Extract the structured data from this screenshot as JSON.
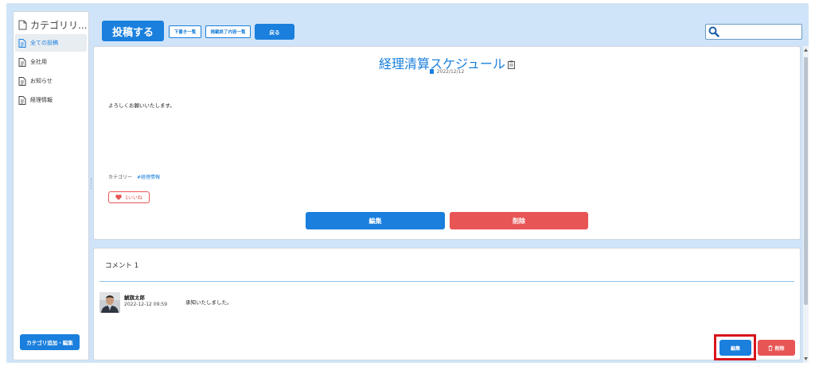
{
  "sidebar": {
    "title": "カテゴリリ...",
    "items": [
      {
        "label": "全ての投稿",
        "active": true
      },
      {
        "label": "全社用",
        "active": false
      },
      {
        "label": "お知らせ",
        "active": false
      },
      {
        "label": "経理情報",
        "active": false
      }
    ],
    "add_button": "カテゴリ追加・編集"
  },
  "toolbar": {
    "post_button": "投稿する",
    "drafts_button": "下書き一覧",
    "ended_button": "掲載終了内容一覧",
    "back_button": "戻る"
  },
  "search": {
    "placeholder": "",
    "value": ""
  },
  "post": {
    "title": "経理清算スケジュール",
    "date": "2022/12/12",
    "body": "よろしくお願いいたします。",
    "category_label": "カテゴリー",
    "category_tag": "#経理情報",
    "like_count": "1",
    "like_label": "いいね",
    "edit_button": "編集",
    "delete_button": "削除"
  },
  "comments": {
    "header": "コメント 1",
    "items": [
      {
        "author": "鯱旗太郎",
        "time": "2022-12-12 09:59",
        "text": "承知いたしました。",
        "edit_button": "編集",
        "delete_button": "削除"
      }
    ]
  },
  "colors": {
    "primary": "#1a7fdd",
    "danger": "#e85555",
    "background": "#cfe4f8",
    "highlight": "#d8141c"
  }
}
